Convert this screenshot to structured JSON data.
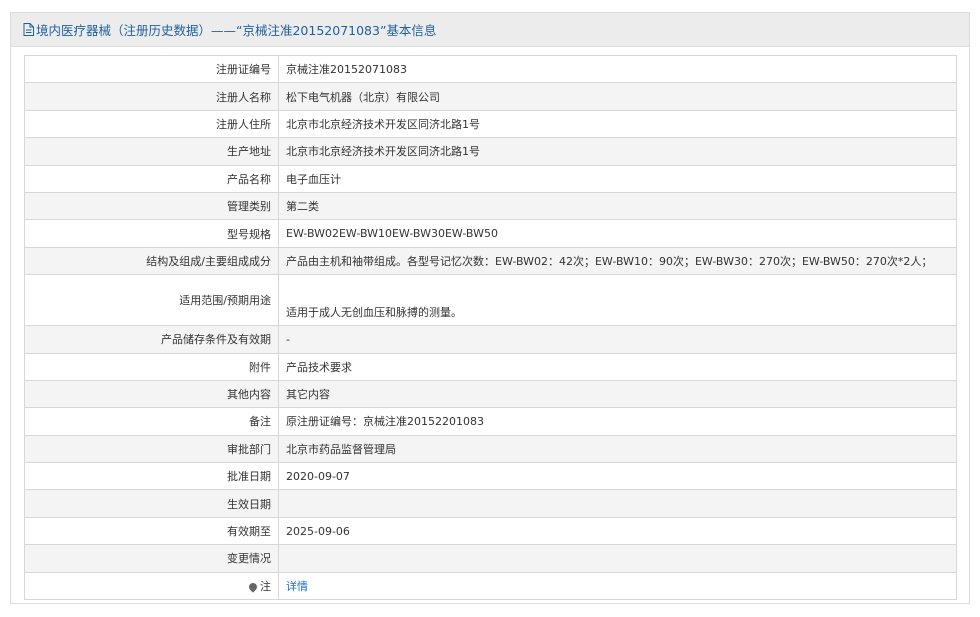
{
  "header": {
    "title": "境内医疗器械（注册历史数据）——“京械注准20152071083”基本信息",
    "icon": "document-icon"
  },
  "rows": [
    {
      "label": "注册证编号",
      "value": "京械注准20152071083"
    },
    {
      "label": "注册人名称",
      "value": "松下电气机器（北京）有限公司"
    },
    {
      "label": "注册人住所",
      "value": "北京市北京经济技术开发区同济北路1号"
    },
    {
      "label": "生产地址",
      "value": "北京市北京经济技术开发区同济北路1号"
    },
    {
      "label": "产品名称",
      "value": "电子血压计"
    },
    {
      "label": "管理类别",
      "value": "第二类"
    },
    {
      "label": "型号规格",
      "value": "EW-BW02EW-BW10EW-BW30EW-BW50"
    },
    {
      "label": "结构及组成/主要组成成分",
      "value": "产品由主机和袖带组成。各型号记忆次数：EW-BW02：42次；EW-BW10：90次；EW-BW30：270次；EW-BW50：270次*2人；"
    },
    {
      "label": "适用范围/预期用途",
      "value": "适用于成人无创血压和脉搏的测量。"
    },
    {
      "label": "产品储存条件及有效期",
      "value": "-"
    },
    {
      "label": "附件",
      "value": "产品技术要求"
    },
    {
      "label": "其他内容",
      "value": "其它内容"
    },
    {
      "label": "备注",
      "value": "原注册证编号：京械注准20152201083"
    },
    {
      "label": "审批部门",
      "value": "北京市药品监督管理局"
    },
    {
      "label": "批准日期",
      "value": "2020-09-07"
    },
    {
      "label": "生效日期",
      "value": ""
    },
    {
      "label": "有效期至",
      "value": "2025-09-06"
    },
    {
      "label": "变更情况",
      "value": ""
    },
    {
      "label": "注",
      "value": "详情",
      "icon": "pin-icon"
    }
  ]
}
